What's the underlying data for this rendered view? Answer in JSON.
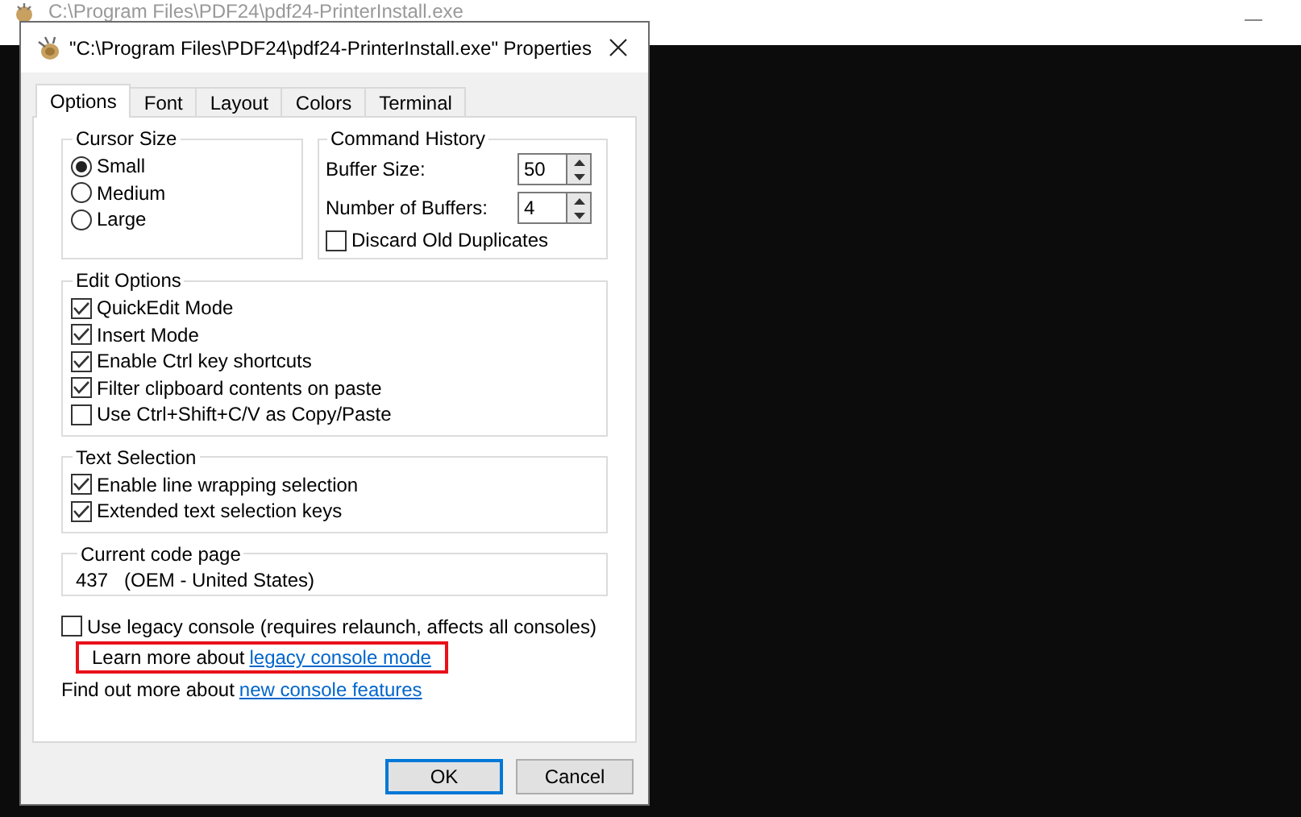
{
  "background_window": {
    "title": "C:\\Program Files\\PDF24\\pdf24-PrinterInstall.exe"
  },
  "dialog": {
    "title": "\"C:\\Program Files\\PDF24\\pdf24-PrinterInstall.exe\" Properties"
  },
  "tabs": [
    {
      "label": "Options",
      "selected": true
    },
    {
      "label": "Font",
      "selected": false
    },
    {
      "label": "Layout",
      "selected": false
    },
    {
      "label": "Colors",
      "selected": false
    },
    {
      "label": "Terminal",
      "selected": false
    }
  ],
  "cursor_size": {
    "label": "Cursor Size",
    "options": [
      {
        "label": "Small",
        "selected": true
      },
      {
        "label": "Medium",
        "selected": false
      },
      {
        "label": "Large",
        "selected": false
      }
    ]
  },
  "command_history": {
    "label": "Command History",
    "fields": [
      {
        "label": "Buffer Size:",
        "value": "50"
      },
      {
        "label": "Number of Buffers:",
        "value": "4"
      }
    ],
    "discard_old_duplicates": {
      "label": "Discard Old Duplicates",
      "checked": false
    }
  },
  "edit_options": {
    "label": "Edit Options",
    "items": [
      {
        "label": "QuickEdit Mode",
        "checked": true
      },
      {
        "label": "Insert Mode",
        "checked": true
      },
      {
        "label": "Enable Ctrl key shortcuts",
        "checked": true
      },
      {
        "label": "Filter clipboard contents on paste",
        "checked": true
      },
      {
        "label": "Use Ctrl+Shift+C/V as Copy/Paste",
        "checked": false
      }
    ]
  },
  "text_selection": {
    "label": "Text Selection",
    "items": [
      {
        "label": "Enable line wrapping selection",
        "checked": true
      },
      {
        "label": "Extended text selection keys",
        "checked": true
      }
    ]
  },
  "code_page": {
    "label": "Current code page",
    "value": "437   (OEM - United States)"
  },
  "legacy_console": {
    "label": "Use legacy console (requires relaunch, affects all consoles)",
    "checked": false
  },
  "learn_more": {
    "text": "Learn more about",
    "link": "legacy console mode",
    "highlighted": true
  },
  "find_more": {
    "text": "Find out more about",
    "link": "new console features"
  },
  "buttons": [
    {
      "label": "OK",
      "default": true
    },
    {
      "label": "Cancel",
      "default": false
    }
  ]
}
